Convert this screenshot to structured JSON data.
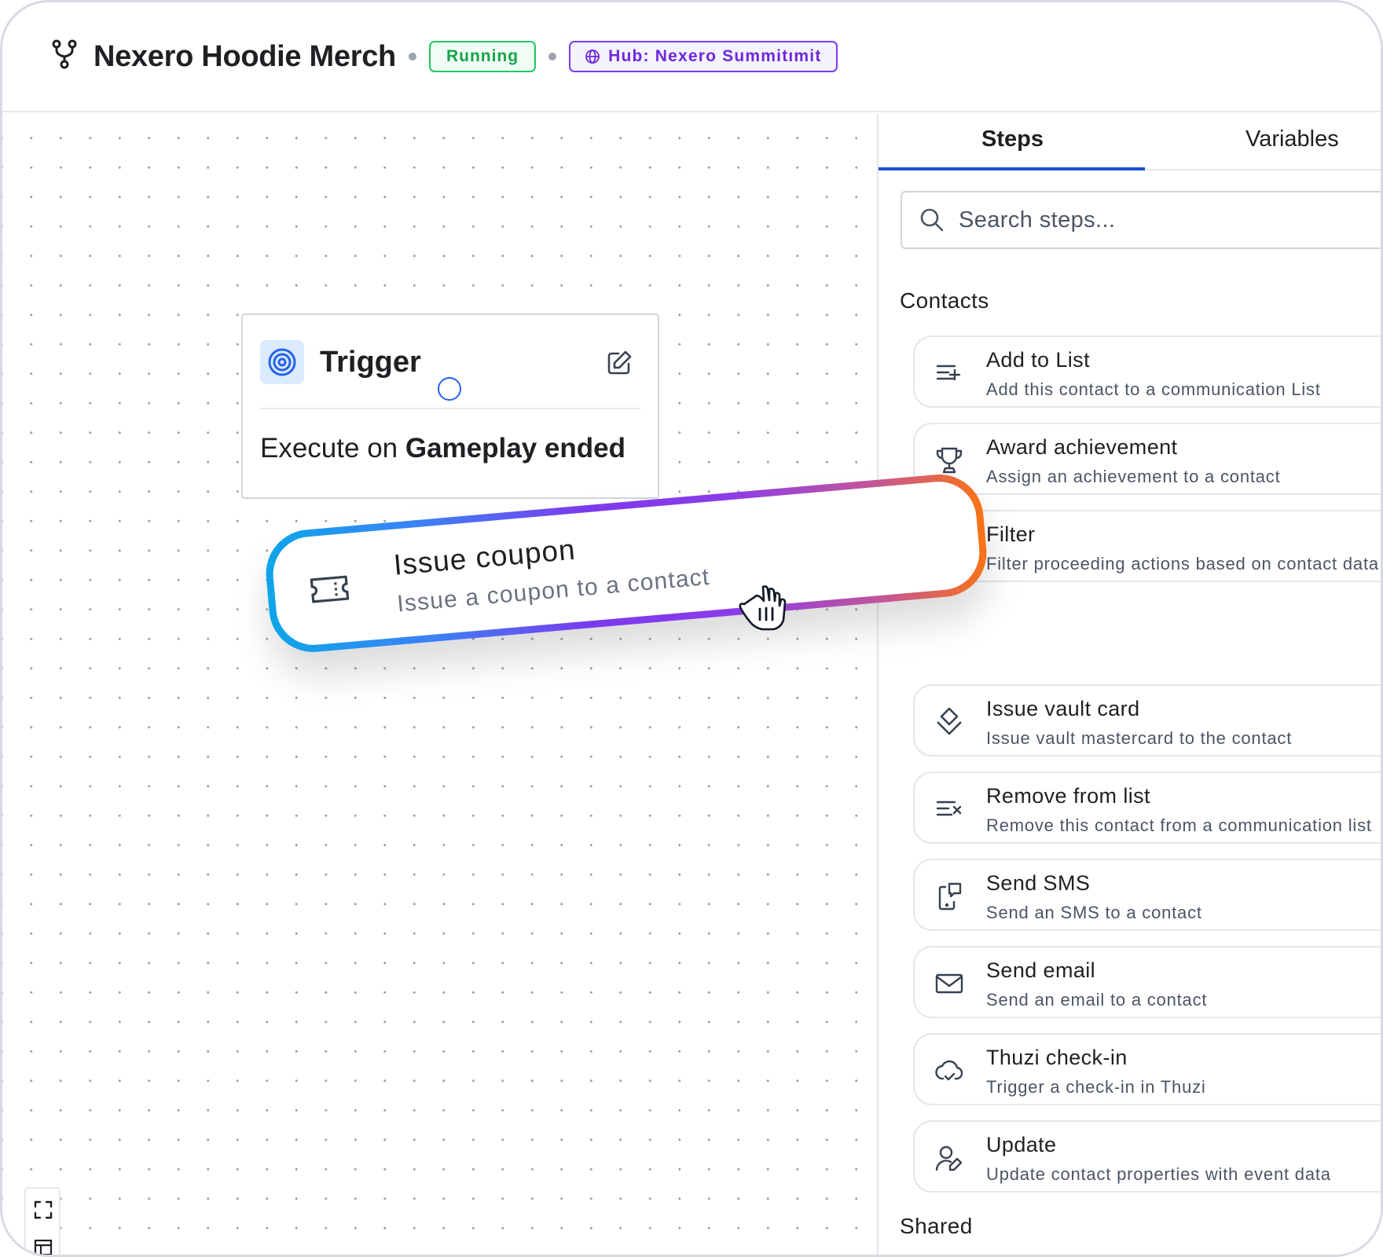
{
  "header": {
    "title": "Nexero Hoodie Merch",
    "status": "Running",
    "hub_label": "Hub: Nexero Summitımit"
  },
  "canvas": {
    "trigger": {
      "title": "Trigger",
      "body_prefix": "Execute on",
      "body_event": "Gameplay ended"
    },
    "dragging_step": {
      "name": "Issue coupon",
      "description": "Issue a coupon to a contact"
    }
  },
  "panel": {
    "tabs": [
      "Steps",
      "Variables"
    ],
    "active_tab": "Steps",
    "search_placeholder": "Search steps...",
    "sections": {
      "contacts": "Contacts",
      "shared": "Shared"
    },
    "steps": [
      {
        "name": "Add to List",
        "description": "Add this contact to a communication List",
        "icon": "list-add-icon"
      },
      {
        "name": "Award achievement",
        "description": "Assign an achievement to a contact",
        "icon": "trophy-icon"
      },
      {
        "name": "Filter",
        "description": "Filter proceeding actions based on contact data",
        "icon": "filter-icon"
      },
      {
        "name": "Issue vault card",
        "description": "Issue vault mastercard to the contact",
        "icon": "vault-card-icon"
      },
      {
        "name": "Remove from list",
        "description": "Remove this contact from a communication list",
        "icon": "list-remove-icon"
      },
      {
        "name": "Send SMS",
        "description": "Send an SMS to a contact",
        "icon": "sms-icon"
      },
      {
        "name": "Send email",
        "description": "Send an email to a contact",
        "icon": "mail-icon"
      },
      {
        "name": "Thuzi check-in",
        "description": "Trigger a check-in in Thuzi",
        "icon": "cloud-check-icon"
      },
      {
        "name": "Update",
        "description": "Update contact properties with event data",
        "icon": "user-edit-icon"
      }
    ]
  },
  "colors": {
    "accent": "#1d4ed8",
    "running": "#22c55e",
    "hub": "#7c3aed",
    "drag_gradient": [
      "#0ea5e9",
      "#7c3aed",
      "#f97316"
    ]
  }
}
